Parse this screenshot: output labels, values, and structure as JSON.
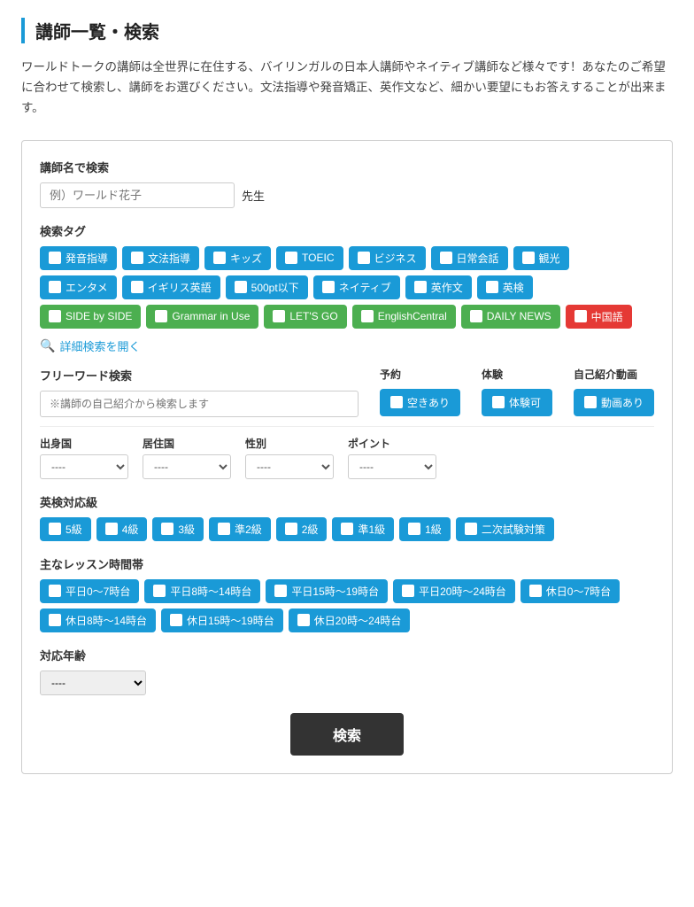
{
  "page": {
    "title": "講師一覧・検索",
    "description": "ワールドトークの講師は全世界に在住する、バイリンガルの日本人講師やネイティブ講師など様々です！あなたのご希望に合わせて検索し、講師をお選びください。文法指導や発音矯正、英作文など、細かい要望にもお答えすることが出来ます。"
  },
  "nameSearch": {
    "label": "講師名で検索",
    "placeholder": "例）ワールド花子",
    "suffix": "先生"
  },
  "tagsSection": {
    "label": "検索タグ",
    "row1": [
      {
        "text": "発音指導",
        "color": "blue"
      },
      {
        "text": "文法指導",
        "color": "blue"
      },
      {
        "text": "キッズ",
        "color": "blue"
      },
      {
        "text": "TOEIC",
        "color": "blue"
      },
      {
        "text": "ビジネス",
        "color": "blue"
      },
      {
        "text": "日常会話",
        "color": "blue"
      },
      {
        "text": "観光",
        "color": "blue"
      }
    ],
    "row2": [
      {
        "text": "エンタメ",
        "color": "blue"
      },
      {
        "text": "イギリス英語",
        "color": "blue"
      },
      {
        "text": "500pt以下",
        "color": "blue"
      },
      {
        "text": "ネイティブ",
        "color": "blue"
      },
      {
        "text": "英作文",
        "color": "blue"
      },
      {
        "text": "英検",
        "color": "blue"
      }
    ],
    "row3": [
      {
        "text": "SIDE by SIDE",
        "color": "green"
      },
      {
        "text": "Grammar in Use",
        "color": "green"
      },
      {
        "text": "LET'S GO",
        "color": "green"
      },
      {
        "text": "EnglishCentral",
        "color": "green"
      },
      {
        "text": "DAILY NEWS",
        "color": "green"
      },
      {
        "text": "中国語",
        "color": "red"
      }
    ]
  },
  "detailToggle": {
    "label": "詳細検索を開く"
  },
  "freeword": {
    "label": "フリーワード検索",
    "placeholder": "※講師の自己紹介から検索します"
  },
  "yoyaku": {
    "label": "予約",
    "button": "空きあり"
  },
  "taiken": {
    "label": "体験",
    "button": "体験可"
  },
  "jikoshokai": {
    "label": "自己紹介動画",
    "button": "動画あり"
  },
  "selects": {
    "shusshin": {
      "label": "出身国",
      "default": "----",
      "options": [
        "----"
      ]
    },
    "kyojyu": {
      "label": "居住国",
      "default": "----",
      "options": [
        "----"
      ]
    },
    "seibetsu": {
      "label": "性別",
      "default": "----",
      "options": [
        "----"
      ]
    },
    "points": {
      "label": "ポイント",
      "default": "----",
      "options": [
        "----"
      ]
    }
  },
  "eiken": {
    "label": "英検対応級",
    "levels": [
      {
        "text": "5級",
        "color": "blue"
      },
      {
        "text": "4級",
        "color": "blue"
      },
      {
        "text": "3級",
        "color": "blue"
      },
      {
        "text": "準2級",
        "color": "blue"
      },
      {
        "text": "2級",
        "color": "blue"
      },
      {
        "text": "準1級",
        "color": "blue"
      },
      {
        "text": "1級",
        "color": "blue"
      },
      {
        "text": "二次試験対策",
        "color": "blue"
      }
    ]
  },
  "timeSlots": {
    "label": "主なレッスン時間帯",
    "row1": [
      {
        "text": "平日0〜7時台",
        "color": "blue"
      },
      {
        "text": "平日8時〜14時台",
        "color": "blue"
      },
      {
        "text": "平日15時〜19時台",
        "color": "blue"
      },
      {
        "text": "平日20時〜24時台",
        "color": "blue"
      },
      {
        "text": "休日0〜7時台",
        "color": "blue"
      }
    ],
    "row2": [
      {
        "text": "休日8時〜14時台",
        "color": "blue"
      },
      {
        "text": "休日15時〜19時台",
        "color": "blue"
      },
      {
        "text": "休日20時〜24時台",
        "color": "blue"
      }
    ]
  },
  "ageSelect": {
    "label": "対応年齢",
    "default": "----",
    "options": [
      "----"
    ]
  },
  "searchButton": {
    "label": "検索"
  }
}
